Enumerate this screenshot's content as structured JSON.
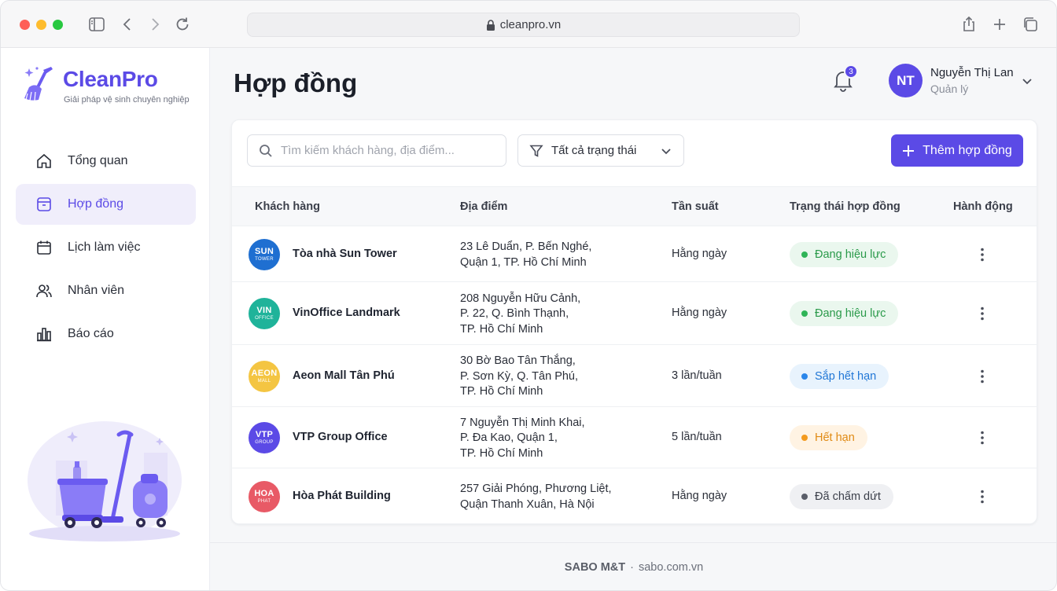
{
  "browser": {
    "url": "cleanpro.vn"
  },
  "brand": {
    "name": "CleanPro",
    "tagline": "Giải pháp vệ sinh chuyên nghiệp",
    "accent": "#5b4ae6"
  },
  "nav": {
    "items": [
      {
        "label": "Tổng quan",
        "icon": "home-icon"
      },
      {
        "label": "Hợp đồng",
        "icon": "contract-icon",
        "active": true
      },
      {
        "label": "Lịch làm việc",
        "icon": "calendar-icon"
      },
      {
        "label": "Nhân viên",
        "icon": "users-icon"
      },
      {
        "label": "Báo cáo",
        "icon": "bar-chart-icon"
      }
    ]
  },
  "header": {
    "title": "Hợp đồng",
    "notifications": "3",
    "user": {
      "initials": "NT",
      "name": "Nguyễn Thị Lan",
      "role": "Quản lý"
    }
  },
  "toolbar": {
    "search_placeholder": "Tìm kiếm khách hàng, địa điểm...",
    "filter_label": "Tất cả trạng thái",
    "add_label": "Thêm hợp đồng"
  },
  "table": {
    "columns": [
      "Khách hàng",
      "Địa điểm",
      "Tần suất",
      "Trạng thái hợp đồng",
      "Hành động"
    ],
    "rows": [
      {
        "logo": [
          "SUN",
          "TOWER"
        ],
        "logo_color": "#1f6fd1",
        "client": "Tòa nhà Sun Tower",
        "address": [
          "23 Lê Duẩn, P. Bến Nghé,",
          "Quận 1, TP. Hồ Chí Minh"
        ],
        "frequency": "Hằng ngày",
        "status": "Đang hiệu lực",
        "status_type": "active"
      },
      {
        "logo": [
          "VIN",
          "OFFICE"
        ],
        "logo_color": "#1fb39a",
        "client": "VinOffice Landmark",
        "address": [
          "208 Nguyễn Hữu Cảnh,",
          "P. 22, Q. Bình Thạnh,",
          "TP. Hồ Chí Minh"
        ],
        "frequency": "Hằng ngày",
        "status": "Đang hiệu lực",
        "status_type": "active"
      },
      {
        "logo": [
          "AEON",
          "MALL"
        ],
        "logo_color": "#f4c542",
        "client": "Aeon Mall Tân Phú",
        "address": [
          "30 Bờ Bao Tân Thắng,",
          "P. Sơn Kỳ, Q. Tân Phú,",
          "TP. Hồ Chí Minh"
        ],
        "frequency": "3 lần/tuần",
        "status": "Sắp hết hạn",
        "status_type": "expiring"
      },
      {
        "logo": [
          "VTP",
          "GROUP"
        ],
        "logo_color": "#5b4ae6",
        "client": "VTP Group Office",
        "address": [
          "7 Nguyễn Thị Minh Khai,",
          "P. Đa Kao, Quận 1,",
          "TP. Hồ Chí Minh"
        ],
        "frequency": "5 lần/tuần",
        "status": "Hết hạn",
        "status_type": "expired"
      },
      {
        "logo": [
          "HOA",
          "PHAT"
        ],
        "logo_color": "#e85a66",
        "client": "Hòa Phát Building",
        "address": [
          "257 Giải Phóng, Phương Liệt,",
          "Quận Thanh Xuân, Hà Nội"
        ],
        "frequency": "Hằng ngày",
        "status": "Đã chấm dứt",
        "status_type": "terminated"
      }
    ]
  },
  "status_colors": {
    "active": {
      "bg": "#eaf7ee",
      "fg": "#2a9a4a",
      "dot": "#2fb457"
    },
    "expiring": {
      "bg": "#e8f3fd",
      "fg": "#2177d6",
      "dot": "#2a86ea"
    },
    "expired": {
      "bg": "#fff3e3",
      "fg": "#e08a14",
      "dot": "#f39a1d"
    },
    "terminated": {
      "bg": "#eff0f3",
      "fg": "#3c404b",
      "dot": "#5a5e69"
    }
  },
  "footer": {
    "company": "SABO M&T",
    "separator": "·",
    "site": "sabo.com.vn"
  }
}
